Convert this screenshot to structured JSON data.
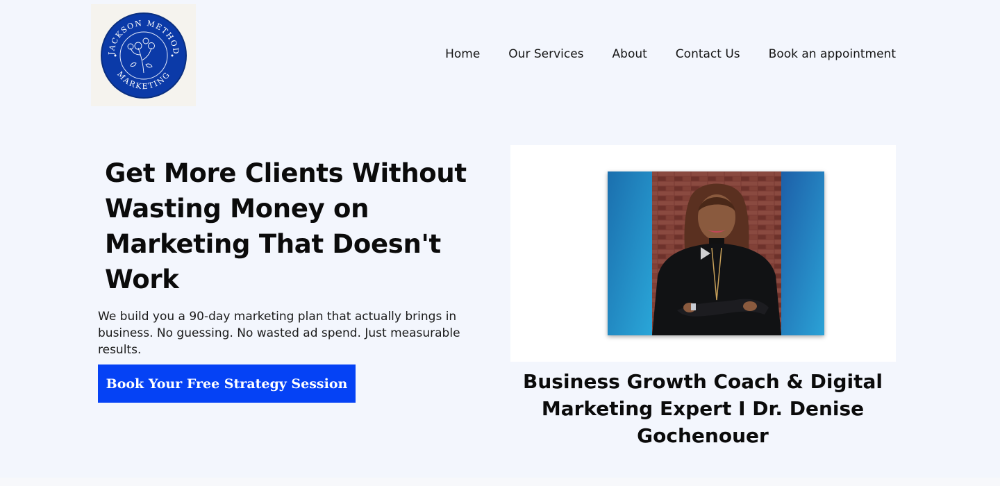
{
  "header": {
    "logo": {
      "text_top": "JACKSON METHOD",
      "text_bottom": "MARKETING",
      "color": "#0b3aa8"
    },
    "nav": [
      {
        "label": "Home"
      },
      {
        "label": "Our Services"
      },
      {
        "label": "About"
      },
      {
        "label": "Contact Us"
      },
      {
        "label": "Book an appointment"
      }
    ]
  },
  "hero": {
    "title": "Get More Clients Without Wasting Money on Marketing That Doesn't Work",
    "subtitle": "We build you a 90-day marketing plan that actually brings in business. No guessing. No wasted ad spend. Just measurable results.",
    "cta_label": "Book Your Free Strategy Session",
    "cta_color": "#0542f5"
  },
  "video": {
    "icon": "play-icon",
    "caption": "Business Growth Coach & Digital Marketing Expert I Dr. Denise Gochenouer"
  }
}
